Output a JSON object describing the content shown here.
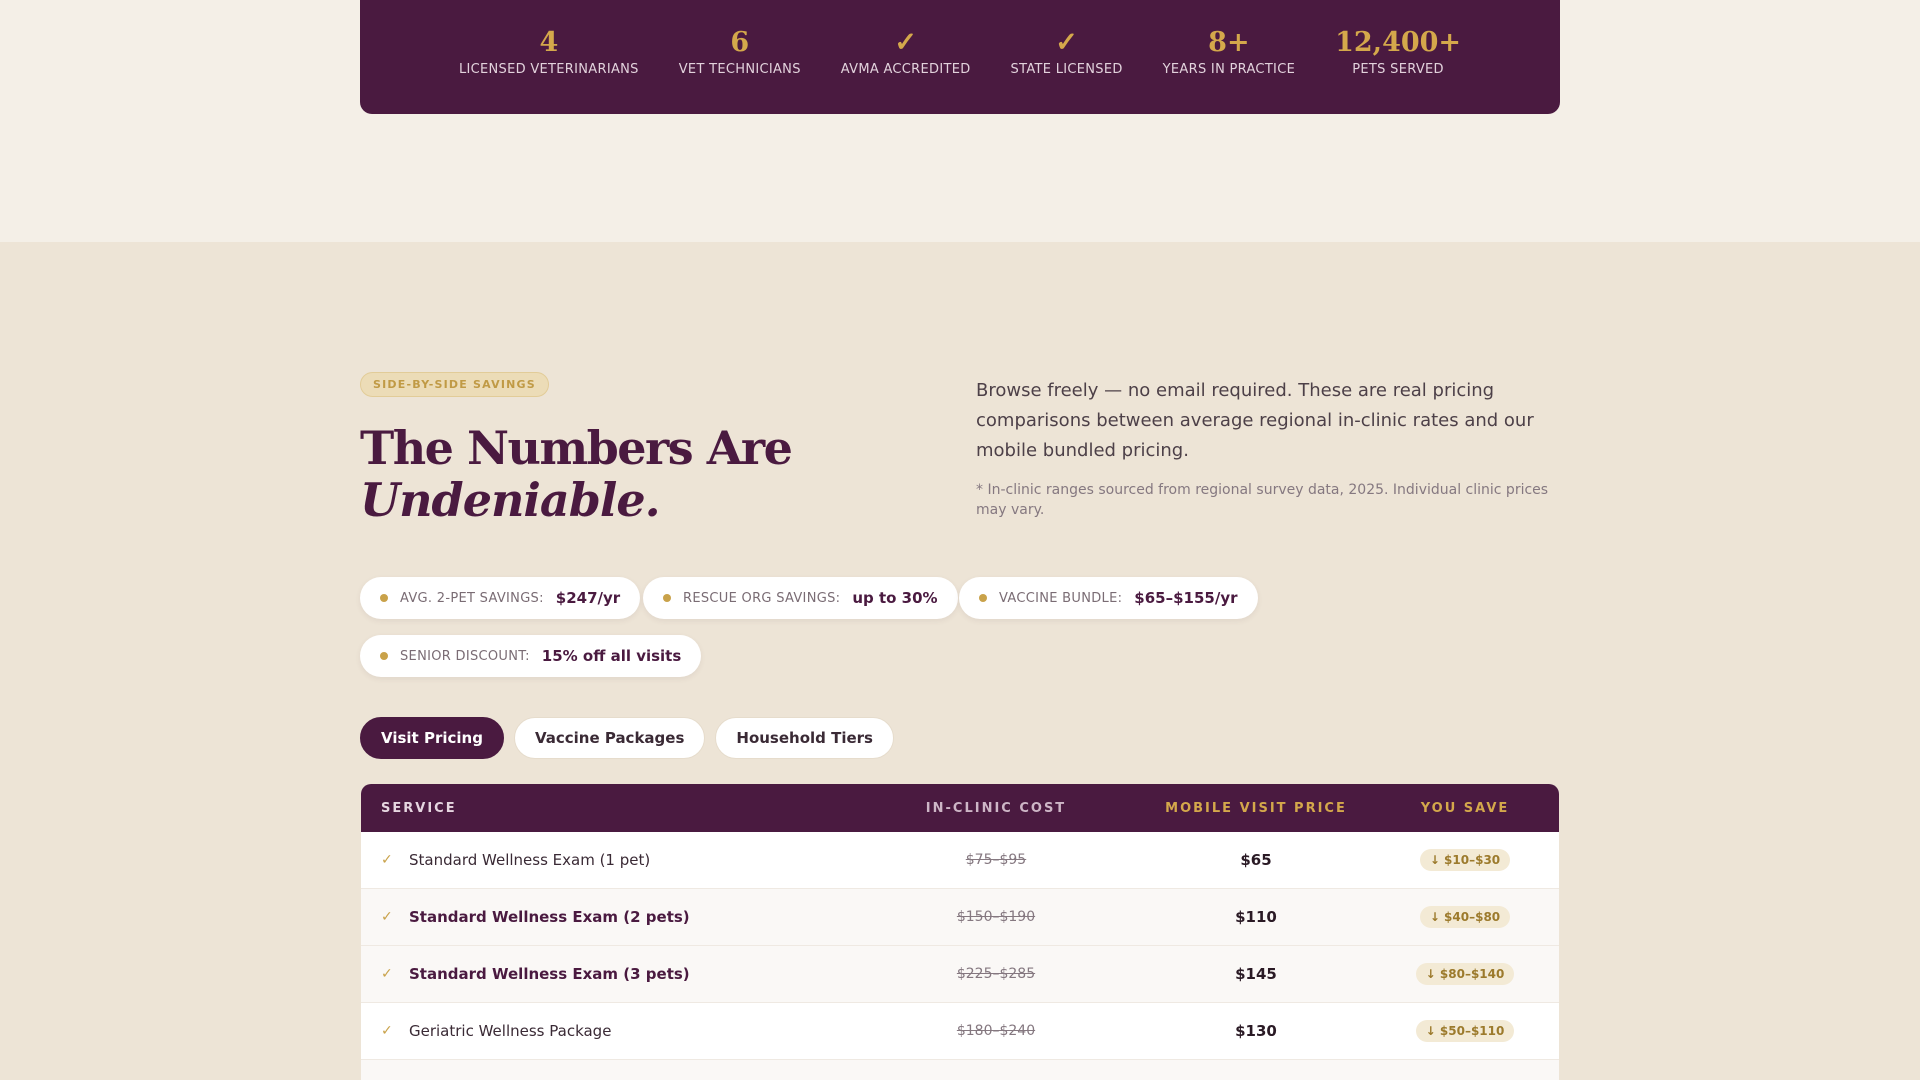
{
  "stats": [
    {
      "value": "4",
      "label": "LICENSED VETERINARIANS"
    },
    {
      "value": "6",
      "label": "VET TECHNICIANS"
    },
    {
      "value": "✓",
      "label": "AVMA ACCREDITED"
    },
    {
      "value": "✓",
      "label": "STATE LICENSED"
    },
    {
      "value": "8+",
      "label": "YEARS IN PRACTICE"
    },
    {
      "value": "12,400+",
      "label": "PETS SERVED"
    }
  ],
  "section": {
    "eyebrow": "SIDE-BY-SIDE SAVINGS",
    "headline_line1": "The Numbers Are",
    "headline_line2": "Undeniable.",
    "intro": "Browse freely — no email required. These are real pricing comparisons between average regional in-clinic rates and our mobile bundled pricing.",
    "footnote": "* In-clinic ranges sourced from regional survey data, 2025. Individual clinic prices may vary."
  },
  "chips": [
    {
      "label": "AVG. 2-PET SAVINGS:",
      "value": "$247/yr"
    },
    {
      "label": "RESCUE ORG SAVINGS:",
      "value": "up to 30%"
    },
    {
      "label": "VACCINE BUNDLE:",
      "value": "$65–$155/yr"
    },
    {
      "label": "SENIOR DISCOUNT:",
      "value": "15% off all visits"
    }
  ],
  "tabs": [
    {
      "label": "Visit Pricing",
      "active": true
    },
    {
      "label": "Vaccine Packages",
      "active": false
    },
    {
      "label": "Household Tiers",
      "active": false
    }
  ],
  "table": {
    "headers": {
      "service": "SERVICE",
      "clinic": "IN-CLINIC COST",
      "mobile": "MOBILE VISIT PRICE",
      "save": "YOU SAVE"
    },
    "rows": [
      {
        "service": "Standard Wellness Exam (1 pet)",
        "clinic": "$75–$95",
        "mobile": "$65",
        "save": "↓ $10–$30",
        "bold": false
      },
      {
        "service": "Standard Wellness Exam (2 pets)",
        "clinic": "$150–$190",
        "mobile": "$110",
        "save": "↓ $40–$80",
        "bold": true
      },
      {
        "service": "Standard Wellness Exam (3 pets)",
        "clinic": "$225–$285",
        "mobile": "$145",
        "save": "↓ $80–$140",
        "bold": true
      },
      {
        "service": "Geriatric Wellness Package",
        "clinic": "$180–$240",
        "mobile": "$130",
        "save": "↓ $50–$110",
        "bold": false
      }
    ]
  }
}
